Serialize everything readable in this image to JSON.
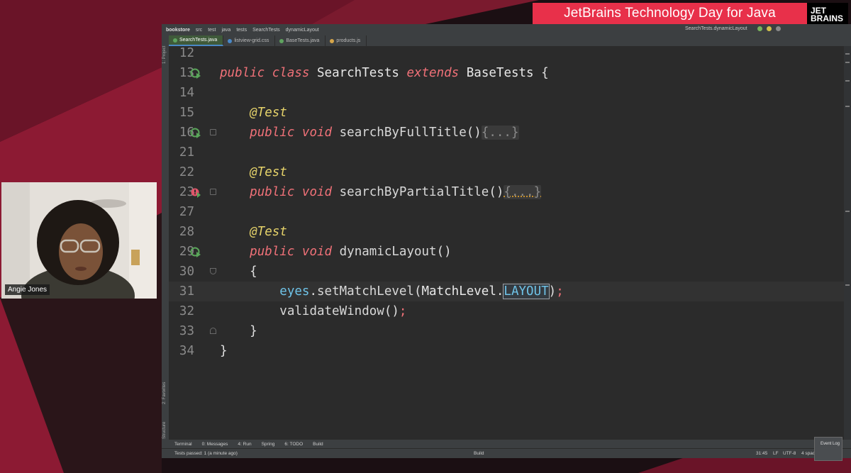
{
  "banner": {
    "title": "JetBrains Technology Day for Java"
  },
  "logo": {
    "line1": "JET",
    "line2": "BRAINS"
  },
  "ide": {
    "breadcrumbs": [
      "bookstore",
      "src",
      "test",
      "java",
      "tests",
      "SearchTests",
      "dynamicLayout"
    ],
    "run_config": "SearchTests.dynamicLayout",
    "tabs": [
      {
        "label": "SearchTests.java",
        "icon_color": "#5fa35f"
      },
      {
        "label": "listview-grid.css",
        "icon_color": "#4a88c7"
      },
      {
        "label": "BaseTests.java",
        "icon_color": "#5fa35f"
      },
      {
        "label": "products.js",
        "icon_color": "#d6a54a"
      }
    ],
    "left_tool_labels": [
      "1: Project",
      "2: Favorites",
      "Z: Structure"
    ],
    "code": {
      "l12": "12",
      "l13": "13",
      "l14": "14",
      "l15": "15",
      "l16": "16",
      "l21": "21",
      "l22": "22",
      "l23": "23",
      "l27": "27",
      "l28": "28",
      "l29": "29",
      "l30": "30",
      "l31": "31",
      "l32": "32",
      "l33": "33",
      "l34": "34",
      "kw_public": "public",
      "kw_class": "class",
      "kw_void": "void",
      "kw_extends": "extends",
      "class_name": "SearchTests",
      "base_class": "BaseTests",
      "annotation": "@Test",
      "m1": "searchByFullTitle",
      "m2": "searchByPartialTitle",
      "m3": "dynamicLayout",
      "folded": "{...}",
      "eyes": "eyes",
      "set_match": "setMatchLevel",
      "match_level": "MatchLevel",
      "layout": "LAYOUT",
      "validate": "validateWindow"
    },
    "bottom_tools": [
      "Terminal",
      "0: Messages",
      "4: Run",
      "Spring",
      "6: TODO",
      "Build"
    ],
    "status": {
      "message": "Tests passed: 1 (a minute ago)",
      "center": "Build",
      "position": "31:45",
      "line_sep": "LF",
      "encoding": "UTF-8",
      "indent": "4 spaces"
    },
    "event_log": "Event Log"
  },
  "webcam": {
    "name": "Angie Jones"
  },
  "colors": {
    "banner_red": "#e8304a",
    "bg_crimson": "#8c1a33",
    "ide_bg": "#2b2b2b",
    "keyword": "#f07178",
    "annotation": "#e6d36a"
  }
}
